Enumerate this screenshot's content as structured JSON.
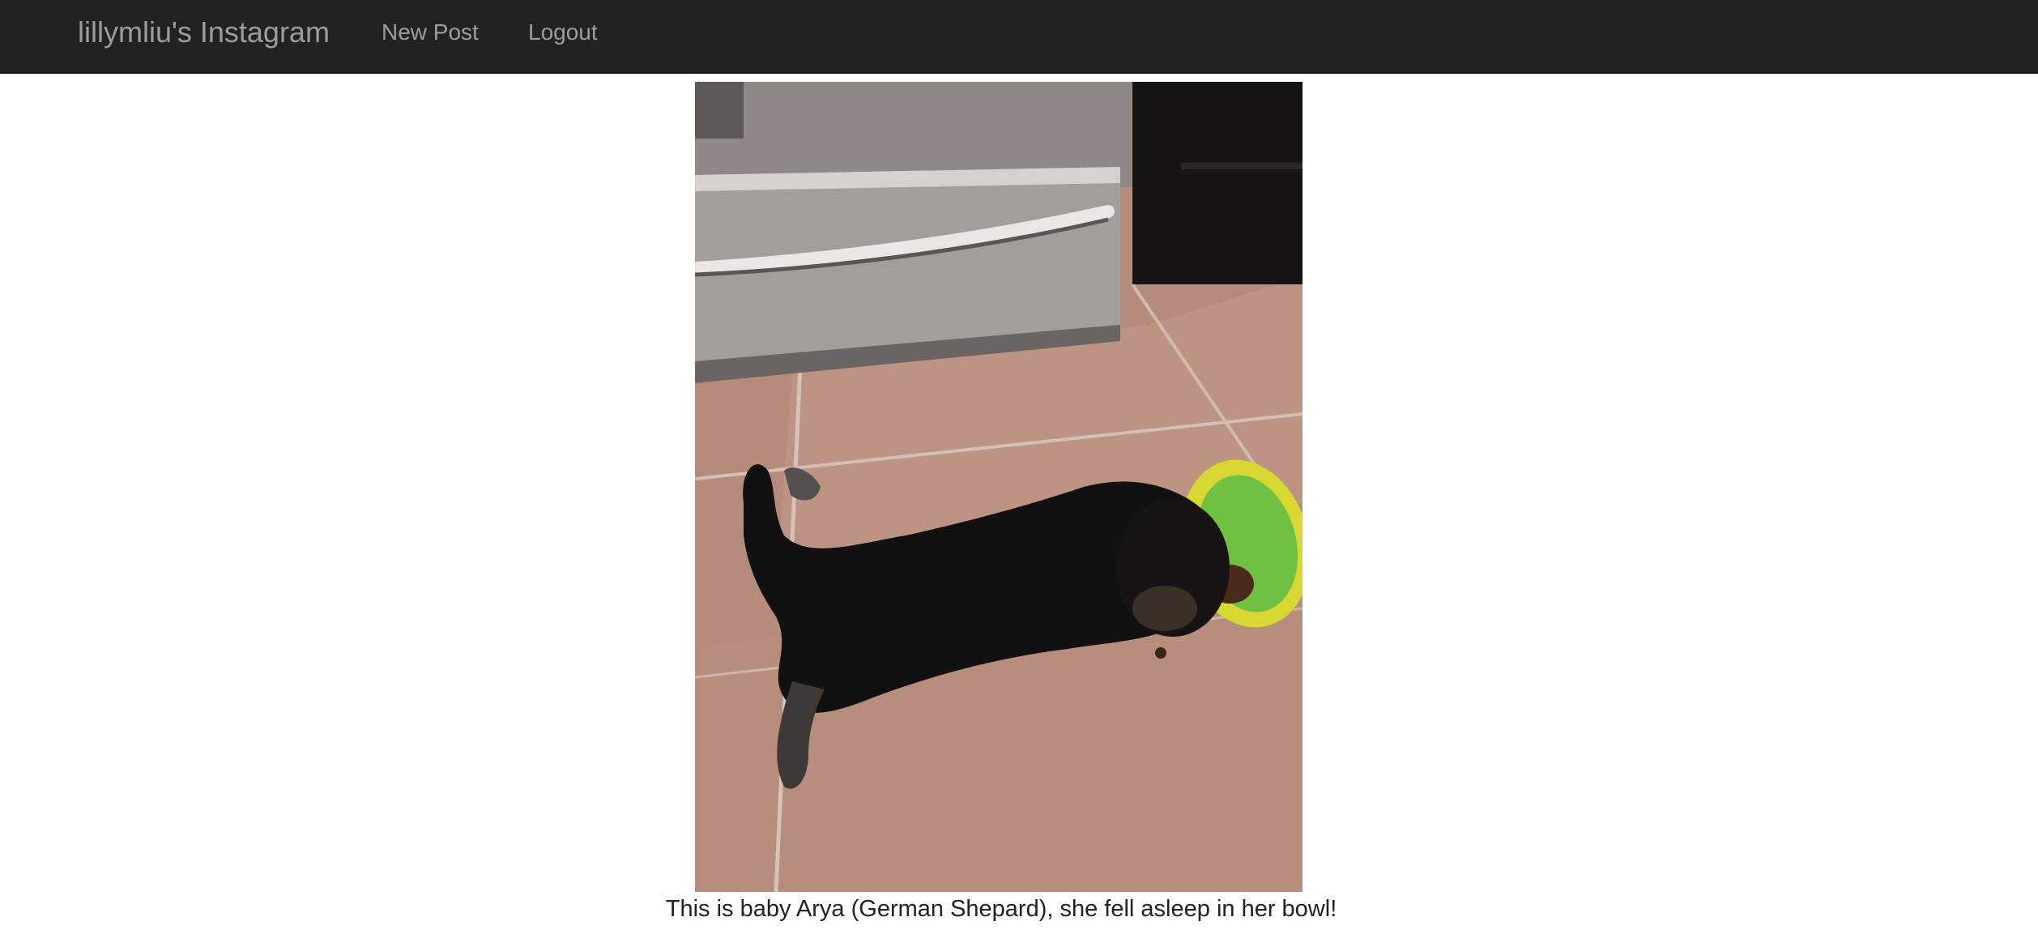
{
  "navbar": {
    "brand": "lillymliu's Instagram",
    "links": [
      {
        "label": "New Post"
      },
      {
        "label": "Logout"
      }
    ]
  },
  "post": {
    "caption": "This is baby Arya (German Shepard), she fell asleep in her bowl!"
  },
  "colors": {
    "navbar_bg": "#222222",
    "nav_text": "#9d9d9d",
    "page_bg": "#ffffff"
  }
}
